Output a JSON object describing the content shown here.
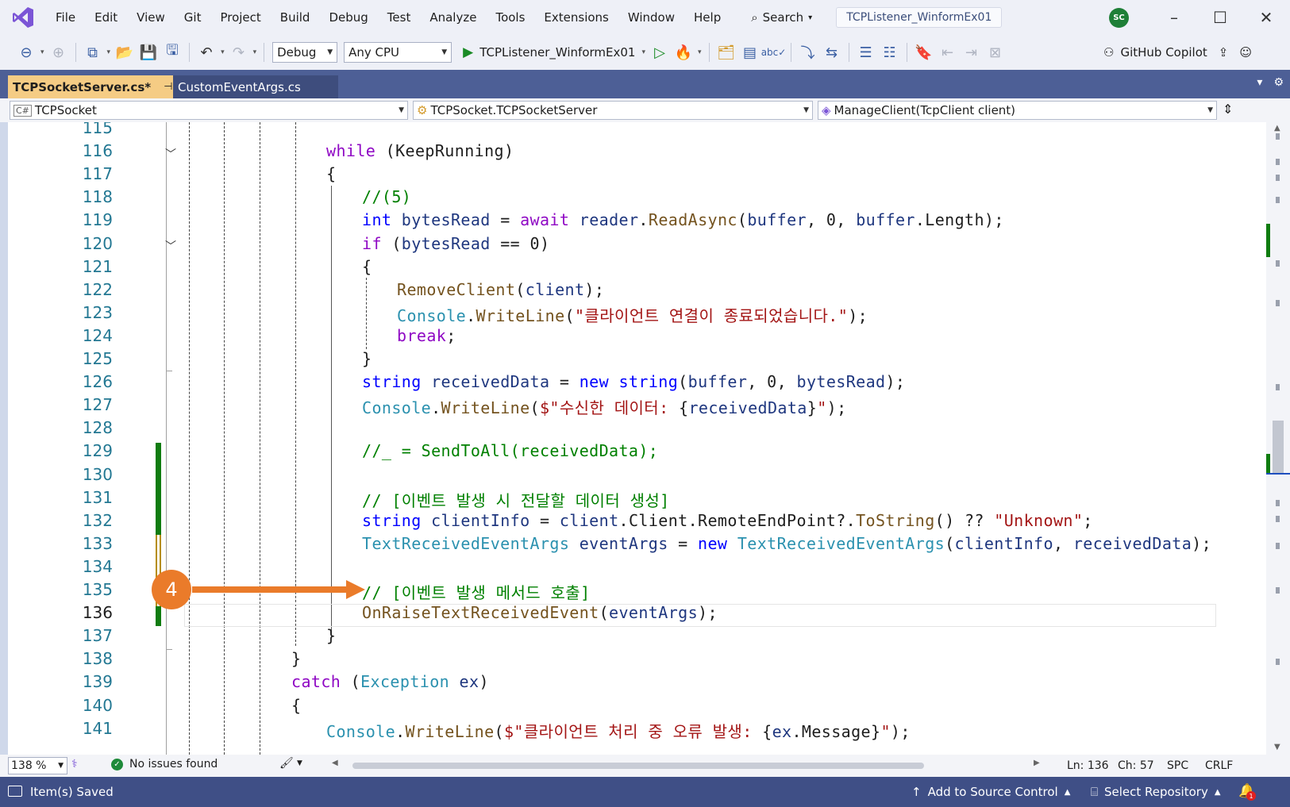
{
  "menu": [
    "File",
    "Edit",
    "View",
    "Git",
    "Project",
    "Build",
    "Debug",
    "Test",
    "Analyze",
    "Tools",
    "Extensions",
    "Window",
    "Help"
  ],
  "search": {
    "label": "Search"
  },
  "solution_name": "TCPListener_WinformEx01",
  "user_initials": "SC",
  "toolbar": {
    "configuration": "Debug",
    "platform": "Any CPU",
    "run_target": "TCPListener_WinformEx01",
    "copilot_label": "GitHub Copilot"
  },
  "tabs": [
    {
      "label": "TCPSocketServer.cs*",
      "active": true
    },
    {
      "label": "CustomEventArgs.cs",
      "active": false
    }
  ],
  "navbar": {
    "project": "TCPSocket",
    "type": "TCPSocket.TCPSocketServer",
    "member": "ManageClient(TcpClient client)"
  },
  "code_lines": [
    {
      "num": "115",
      "tokens": []
    },
    {
      "num": "116",
      "tokens": [
        [
          "cf",
          "while"
        ],
        [
          "pl",
          " (KeepRunning)"
        ]
      ]
    },
    {
      "num": "117",
      "tokens": [
        [
          "pl",
          "{"
        ]
      ]
    },
    {
      "num": "118",
      "tokens": [
        [
          "cm",
          "//(5)"
        ]
      ]
    },
    {
      "num": "119",
      "tokens": [
        [
          "kw",
          "int"
        ],
        [
          "pl",
          " "
        ],
        [
          "pa",
          "bytesRead"
        ],
        [
          "pl",
          " = "
        ],
        [
          "cf",
          "await"
        ],
        [
          "pl",
          " "
        ],
        [
          "pa",
          "reader"
        ],
        [
          "pl",
          "."
        ],
        [
          "me",
          "ReadAsync"
        ],
        [
          "pl",
          "("
        ],
        [
          "pa",
          "buffer"
        ],
        [
          "pl",
          ", 0, "
        ],
        [
          "pa",
          "buffer"
        ],
        [
          "pl",
          ".Length);"
        ]
      ]
    },
    {
      "num": "120",
      "tokens": [
        [
          "cf",
          "if"
        ],
        [
          "pl",
          " ("
        ],
        [
          "pa",
          "bytesRead"
        ],
        [
          "pl",
          " == 0)"
        ]
      ]
    },
    {
      "num": "121",
      "tokens": [
        [
          "pl",
          "{"
        ]
      ]
    },
    {
      "num": "122",
      "tokens": [
        [
          "me",
          "RemoveClient"
        ],
        [
          "pl",
          "("
        ],
        [
          "pa",
          "client"
        ],
        [
          "pl",
          ");"
        ]
      ]
    },
    {
      "num": "123",
      "tokens": [
        [
          "ty",
          "Console"
        ],
        [
          "pl",
          "."
        ],
        [
          "me",
          "WriteLine"
        ],
        [
          "pl",
          "("
        ],
        [
          "st",
          "\"클라이언트 연결이 종료되었습니다.\""
        ],
        [
          "pl",
          ");"
        ]
      ]
    },
    {
      "num": "124",
      "tokens": [
        [
          "cf",
          "break"
        ],
        [
          "pl",
          ";"
        ]
      ]
    },
    {
      "num": "125",
      "tokens": [
        [
          "pl",
          "}"
        ]
      ]
    },
    {
      "num": "126",
      "tokens": [
        [
          "kw",
          "string"
        ],
        [
          "pl",
          " "
        ],
        [
          "pa",
          "receivedData"
        ],
        [
          "pl",
          " = "
        ],
        [
          "kw",
          "new"
        ],
        [
          "pl",
          " "
        ],
        [
          "kw",
          "string"
        ],
        [
          "pl",
          "("
        ],
        [
          "pa",
          "buffer"
        ],
        [
          "pl",
          ", 0, "
        ],
        [
          "pa",
          "bytesRead"
        ],
        [
          "pl",
          ");"
        ]
      ]
    },
    {
      "num": "127",
      "tokens": [
        [
          "ty",
          "Console"
        ],
        [
          "pl",
          "."
        ],
        [
          "me",
          "WriteLine"
        ],
        [
          "pl",
          "("
        ],
        [
          "st",
          "$\"수신한 데이터: "
        ],
        [
          "pl",
          "{"
        ],
        [
          "pa",
          "receivedData"
        ],
        [
          "pl",
          "}"
        ],
        [
          "st",
          "\""
        ],
        [
          "pl",
          ");"
        ]
      ]
    },
    {
      "num": "128",
      "tokens": []
    },
    {
      "num": "129",
      "tokens": [
        [
          "cm",
          "//_ = SendToAll(receivedData);"
        ]
      ]
    },
    {
      "num": "130",
      "tokens": []
    },
    {
      "num": "131",
      "tokens": [
        [
          "cm",
          "// [이벤트 발생 시 전달할 데이터 생성]"
        ]
      ]
    },
    {
      "num": "132",
      "tokens": [
        [
          "kw",
          "string"
        ],
        [
          "pl",
          " "
        ],
        [
          "pa",
          "clientInfo"
        ],
        [
          "pl",
          " = "
        ],
        [
          "pa",
          "client"
        ],
        [
          "pl",
          ".Client.RemoteEndPoint?."
        ],
        [
          "me",
          "ToString"
        ],
        [
          "pl",
          "() ?? "
        ],
        [
          "st",
          "\"Unknown\""
        ],
        [
          "pl",
          ";"
        ]
      ]
    },
    {
      "num": "133",
      "tokens": [
        [
          "ty",
          "TextReceivedEventArgs"
        ],
        [
          "pl",
          " "
        ],
        [
          "pa",
          "eventArgs"
        ],
        [
          "pl",
          " = "
        ],
        [
          "kw",
          "new"
        ],
        [
          "pl",
          " "
        ],
        [
          "ty",
          "TextReceivedEventArgs"
        ],
        [
          "pl",
          "("
        ],
        [
          "pa",
          "clientInfo"
        ],
        [
          "pl",
          ", "
        ],
        [
          "pa",
          "receivedData"
        ],
        [
          "pl",
          ");"
        ]
      ]
    },
    {
      "num": "134",
      "tokens": []
    },
    {
      "num": "135",
      "tokens": [
        [
          "cm",
          "// [이벤트 발생 메서드 호출]"
        ]
      ]
    },
    {
      "num": "136",
      "tokens": [
        [
          "me",
          "OnRaiseTextReceivedEvent"
        ],
        [
          "pl",
          "("
        ],
        [
          "pa",
          "eventArgs"
        ],
        [
          "pl",
          ");"
        ]
      ]
    },
    {
      "num": "137",
      "tokens": [
        [
          "pl",
          "}"
        ]
      ]
    },
    {
      "num": "138",
      "tokens": [
        [
          "pl",
          "}"
        ]
      ]
    },
    {
      "num": "139",
      "tokens": [
        [
          "cf",
          "catch"
        ],
        [
          "pl",
          " ("
        ],
        [
          "ty",
          "Exception"
        ],
        [
          "pl",
          " "
        ],
        [
          "pa",
          "ex"
        ],
        [
          "pl",
          ")"
        ]
      ]
    },
    {
      "num": "140",
      "tokens": [
        [
          "pl",
          "{"
        ]
      ]
    },
    {
      "num": "141",
      "tokens": [
        [
          "ty",
          "Console"
        ],
        [
          "pl",
          "."
        ],
        [
          "me",
          "WriteLine"
        ],
        [
          "pl",
          "("
        ],
        [
          "st",
          "$\"클라이언트 처리 중 오류 발생: "
        ],
        [
          "pl",
          "{"
        ],
        [
          "pa",
          "ex"
        ],
        [
          "pl",
          ".Message}"
        ],
        [
          "st",
          "\""
        ],
        [
          "pl",
          ");"
        ]
      ]
    }
  ],
  "callout": {
    "number": "4"
  },
  "editor_status": {
    "zoom": "138 %",
    "issues": "No issues found",
    "line": "Ln: 136",
    "char": "Ch: 57",
    "whitespace": "SPC",
    "line_ending": "CRLF"
  },
  "statusbar": {
    "message": "Item(s) Saved",
    "add_source_control": "Add to Source Control",
    "select_repository": "Select Repository",
    "notifications": "1"
  },
  "colors": {
    "accent_tab": "#f5cc84",
    "statusbar": "#3f4f86",
    "callout": "#ea7b2a",
    "change_saved": "#107c10",
    "change_unsaved": "#b58d00"
  }
}
